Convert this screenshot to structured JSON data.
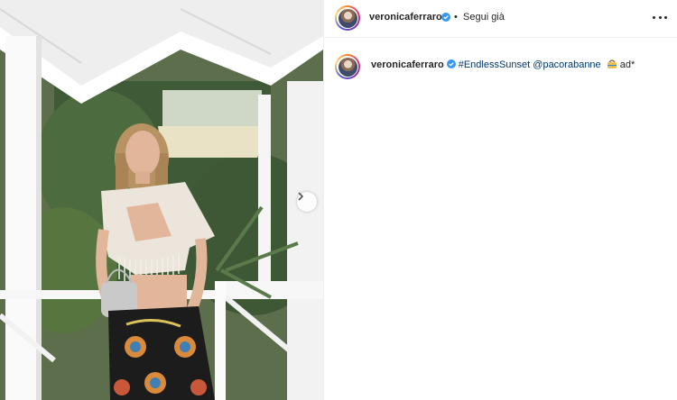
{
  "post": {
    "photo_alt": "photo",
    "next_icon": "chevron-right-icon"
  },
  "header": {
    "username": "veronicaferraro",
    "separator": "•",
    "follow_label": "Segui già",
    "more_icon": "more-horizontal-icon"
  },
  "caption": {
    "username": "veronicaferraro",
    "hashtag": "#EndlessSunset",
    "mention": "@pacorabanne",
    "emoji": "handbag-emoji",
    "suffix": "ad*"
  },
  "colors": {
    "verified": "#3897f0",
    "link": "#00376b",
    "divider": "#efefef"
  }
}
